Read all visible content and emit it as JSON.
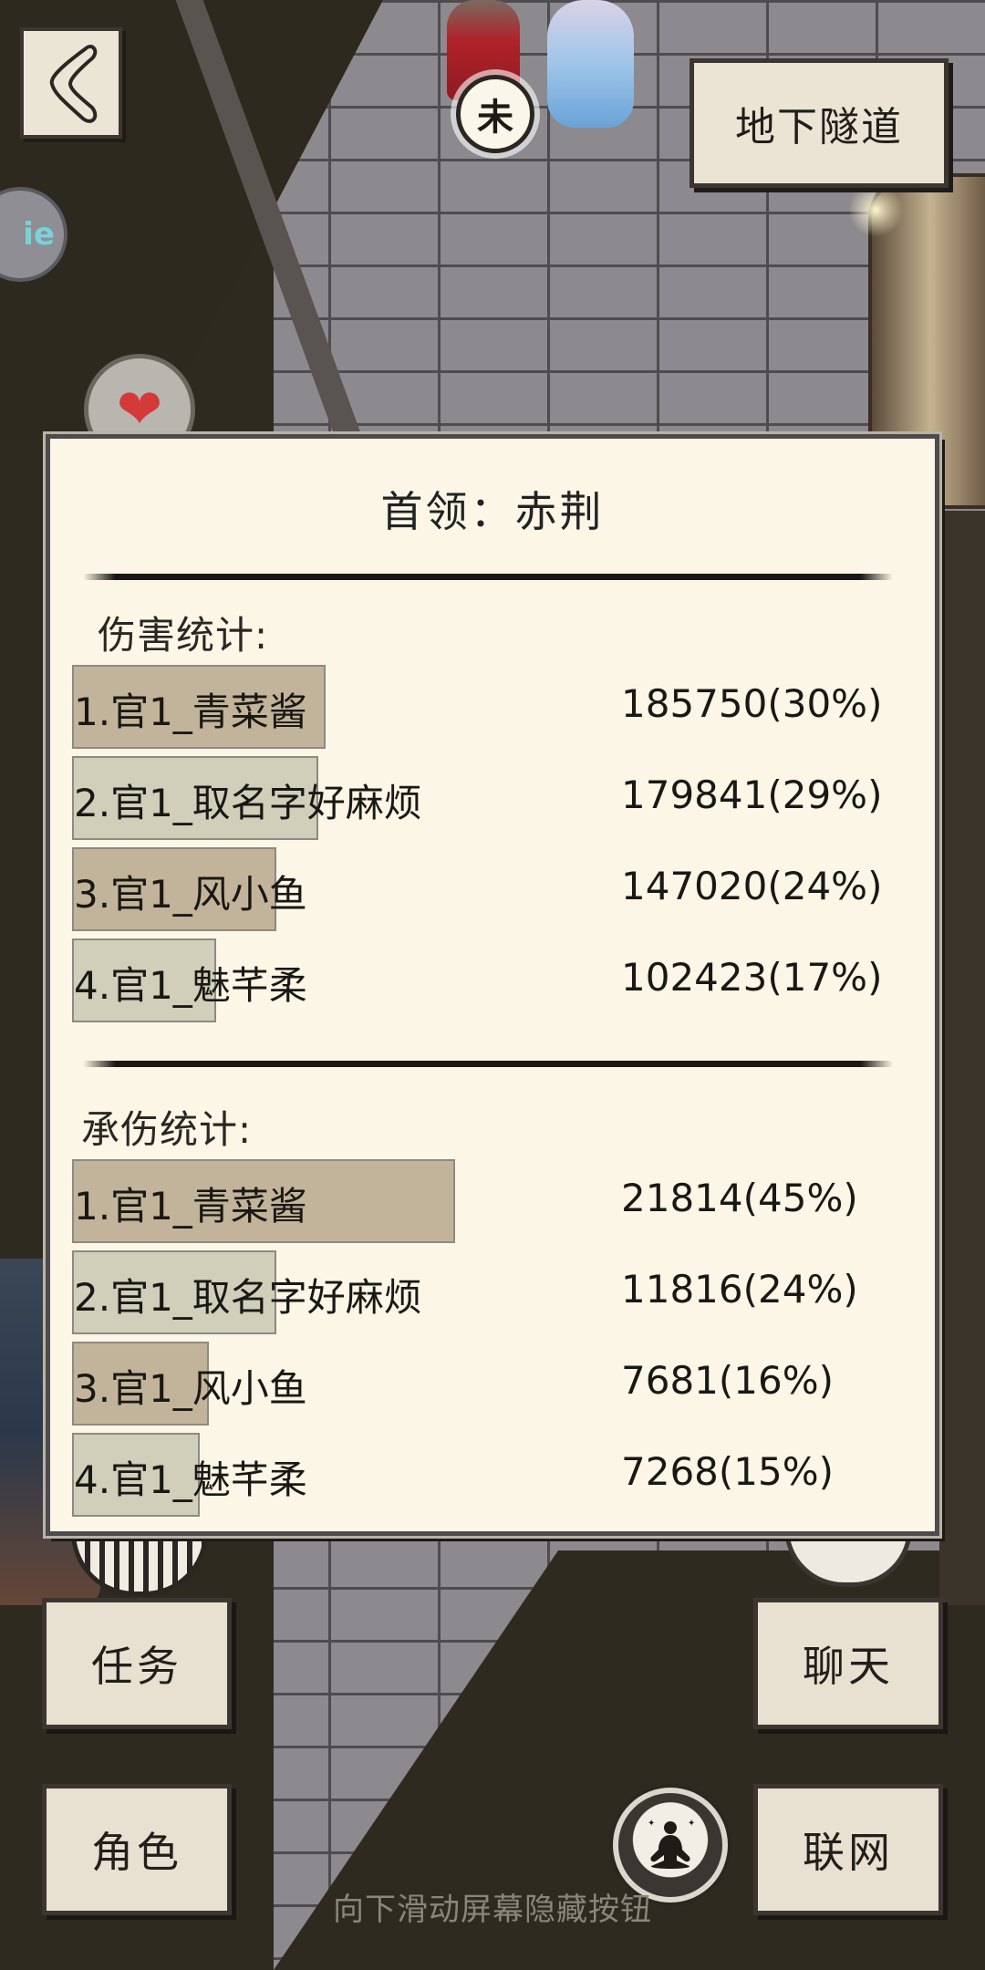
{
  "location_label": "地下隧道",
  "npc_badge_glyph": "未",
  "side_orb_text": "ie",
  "boss": {
    "label": "首领：",
    "name": "赤荆"
  },
  "damage_stats": {
    "title": "伤害统计:",
    "rows": [
      {
        "name": "1.官1_青菜酱",
        "value": "185750(30%)",
        "share": 30,
        "color": "#c2b49a"
      },
      {
        "name": "2.官1_取名字好麻烦",
        "value": "179841(29%)",
        "share": 29,
        "color": "#cfcfba"
      },
      {
        "name": "3.官1_风小鱼",
        "value": "147020(24%)",
        "share": 24,
        "color": "#c2b49a"
      },
      {
        "name": "4.官1_魅芊柔",
        "value": "102423(17%)",
        "share": 17,
        "color": "#cfcfba"
      }
    ]
  },
  "tank_stats": {
    "title": "承伤统计:",
    "rows": [
      {
        "name": "1.官1_青菜酱",
        "value": "21814(45%)",
        "share": 45,
        "color": "#c2b49a"
      },
      {
        "name": "2.官1_取名字好麻烦",
        "value": "11816(24%)",
        "share": 24,
        "color": "#cfcfba"
      },
      {
        "name": "3.官1_风小鱼",
        "value": "7681(16%)",
        "share": 16,
        "color": "#c2b49a"
      },
      {
        "name": "4.官1_魅芊柔",
        "value": "7268(15%)",
        "share": 15,
        "color": "#cfcfba"
      }
    ]
  },
  "buttons": {
    "quest": "任务",
    "chat": "聊天",
    "character": "角色",
    "network": "联网"
  },
  "hint": "向下滑动屏幕隐藏按钮",
  "icons": {
    "back": "chevron-left-icon",
    "meditate": "meditate-icon",
    "heart": "heart-icon"
  }
}
